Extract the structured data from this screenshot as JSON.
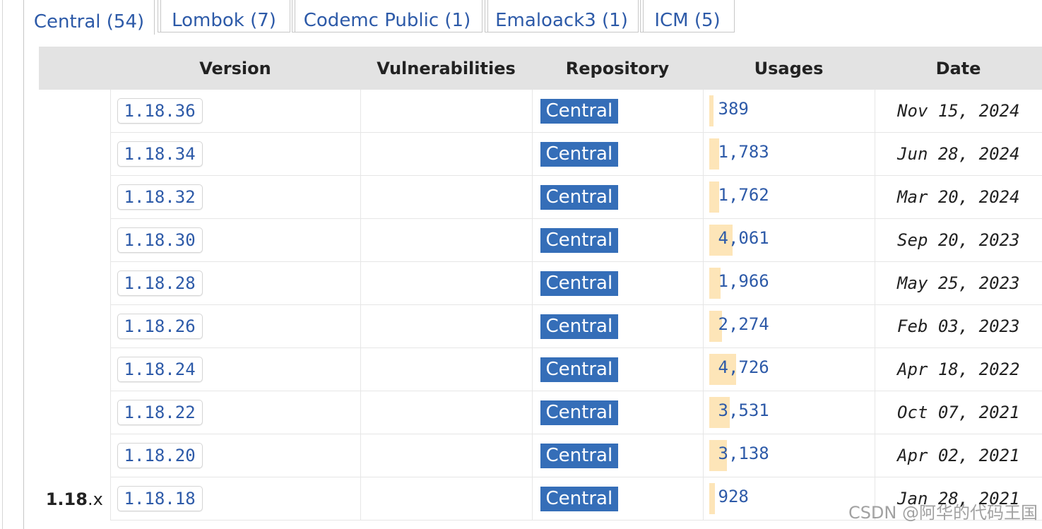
{
  "tabs": [
    {
      "label": "Central (54)",
      "active": true
    },
    {
      "label": "Lombok (7)",
      "active": false
    },
    {
      "label": "Codemc Public (1)",
      "active": false
    },
    {
      "label": "Emaloack3 (1)",
      "active": false
    },
    {
      "label": "ICM (5)",
      "active": false
    }
  ],
  "table": {
    "headers": {
      "version": "Version",
      "vulnerabilities": "Vulnerabilities",
      "repository": "Repository",
      "usages": "Usages",
      "date": "Date"
    },
    "group": {
      "major": "1.18",
      "suffix": ".x"
    },
    "rows": [
      {
        "version": "1.18.36",
        "repository": "Central",
        "usages": "389",
        "usage_level": 0.08,
        "date": "Nov 15, 2024"
      },
      {
        "version": "1.18.34",
        "repository": "Central",
        "usages": "1,783",
        "usage_level": 0.38,
        "date": "Jun 28, 2024"
      },
      {
        "version": "1.18.32",
        "repository": "Central",
        "usages": "1,762",
        "usage_level": 0.37,
        "date": "Mar 20, 2024"
      },
      {
        "version": "1.18.30",
        "repository": "Central",
        "usages": "4,061",
        "usage_level": 0.86,
        "date": "Sep 20, 2023"
      },
      {
        "version": "1.18.28",
        "repository": "Central",
        "usages": "1,966",
        "usage_level": 0.42,
        "date": "May 25, 2023"
      },
      {
        "version": "1.18.26",
        "repository": "Central",
        "usages": "2,274",
        "usage_level": 0.48,
        "date": "Feb 03, 2023"
      },
      {
        "version": "1.18.24",
        "repository": "Central",
        "usages": "4,726",
        "usage_level": 1.0,
        "date": "Apr 18, 2022"
      },
      {
        "version": "1.18.22",
        "repository": "Central",
        "usages": "3,531",
        "usage_level": 0.75,
        "date": "Oct 07, 2021"
      },
      {
        "version": "1.18.20",
        "repository": "Central",
        "usages": "3,138",
        "usage_level": 0.66,
        "date": "Apr 02, 2021"
      },
      {
        "version": "1.18.18",
        "repository": "Central",
        "usages": "928",
        "usage_level": 0.2,
        "date": "Jan 28, 2021"
      }
    ]
  },
  "watermark": "CSDN @阿华的代码王国",
  "colors": {
    "link": "#2d5aa8",
    "badge": "#356eb8",
    "usage_bar": "#fde5b8",
    "header_bg": "#e3e3e3"
  }
}
